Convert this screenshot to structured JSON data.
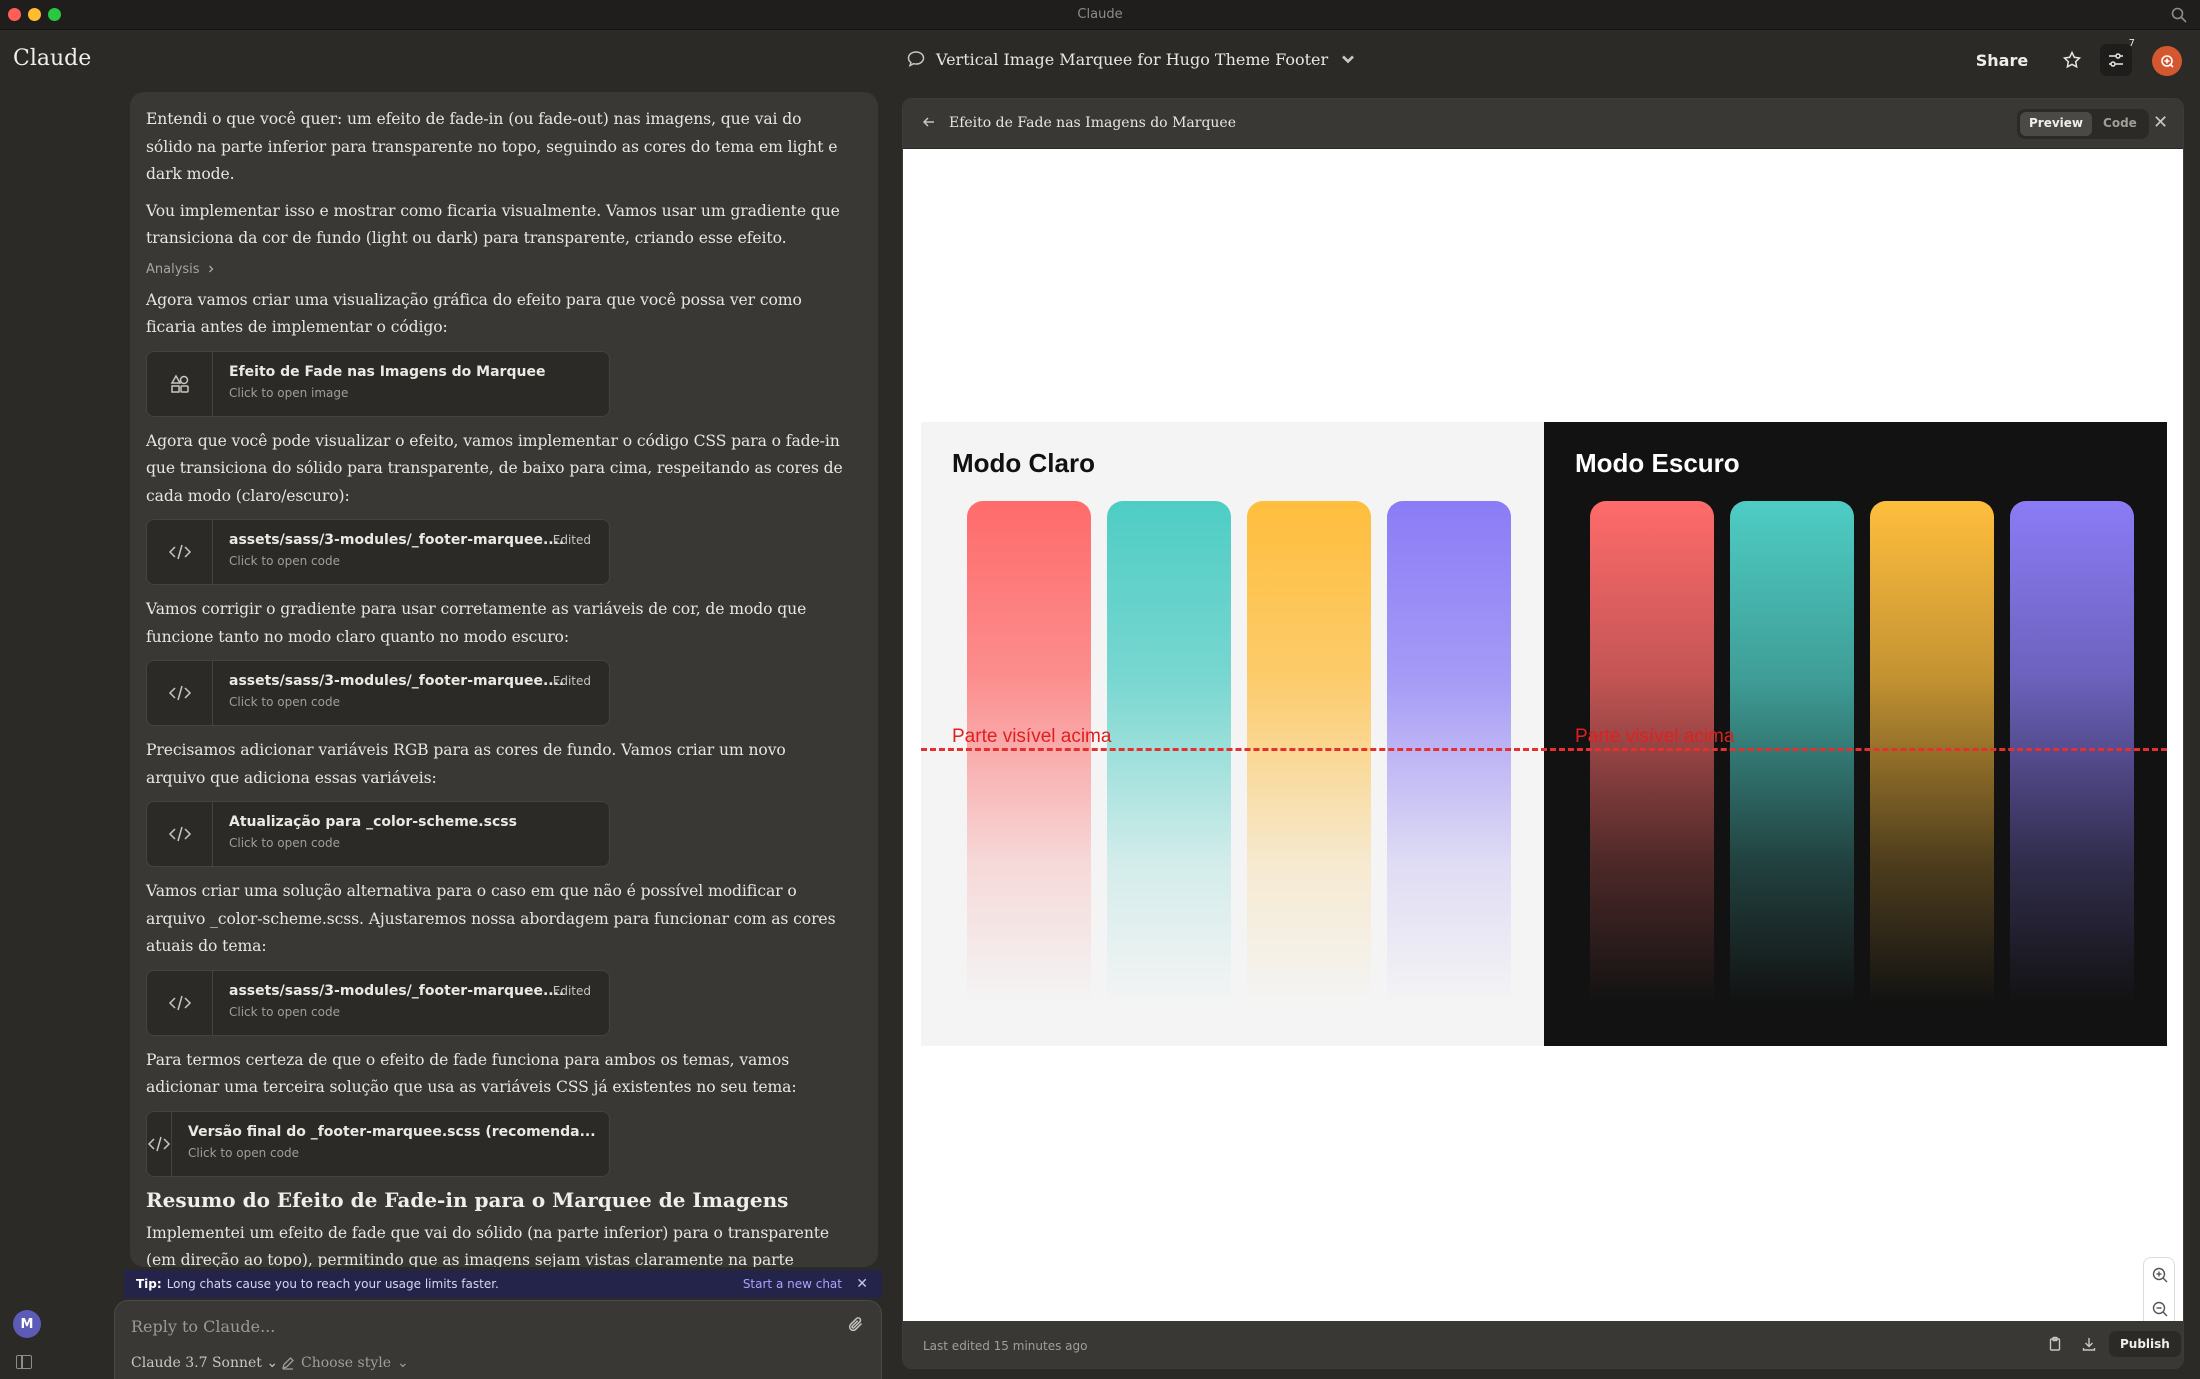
{
  "window": {
    "title": "Claude"
  },
  "header": {
    "brand": "Claude",
    "conversation_title": "Vertical Image Marquee for Hugo Theme Footer",
    "share_label": "Share",
    "notifications_count": "7"
  },
  "chat": {
    "paragraphs": [
      "Entendi o que você quer: um efeito de fade-in (ou fade-out) nas imagens, que vai do sólido na parte inferior para transparente no topo, seguindo as cores do tema em light e dark mode.",
      "Vou implementar isso e mostrar como ficaria visualmente. Vamos usar um gradiente que transiciona da cor de fundo (light ou dark) para transparente, criando esse efeito.",
      "Agora vamos criar uma visualização gráfica do efeito para que você possa ver como ficaria antes de implementar o código:",
      "Agora que você pode visualizar o efeito, vamos implementar o código CSS para o fade-in que transiciona do sólido para transparente, de baixo para cima, respeitando as cores de cada modo (claro/escuro):",
      "Vamos corrigir o gradiente para usar corretamente as variáveis de cor, de modo que funcione tanto no modo claro quanto no modo escuro:",
      "Precisamos adicionar variáveis RGB para as cores de fundo. Vamos criar um novo arquivo que adiciona essas variáveis:",
      "Vamos criar uma solução alternativa para o caso em que não é possível modificar o arquivo _color-scheme.scss. Ajustaremos nossa abordagem para funcionar com as cores atuais do tema:",
      "Para termos certeza de que o efeito de fade funciona para ambos os temas, vamos adicionar uma terceira solução que usa as variáveis CSS já existentes no seu tema:",
      "Implementei um efeito de fade que vai do sólido (na parte inferior) para o transparente (em direção ao topo), permitindo que as imagens sejam vistas claramente na parte"
    ],
    "analysis_label": "Analysis",
    "artifacts": [
      {
        "title": "Efeito de Fade nas Imagens do Marquee",
        "subtitle": "Click to open image",
        "edited": ""
      },
      {
        "title": "assets/sass/3-modules/_footer-marquee....",
        "subtitle": "Click to open code",
        "edited": "Edited"
      },
      {
        "title": "assets/sass/3-modules/_footer-marquee....",
        "subtitle": "Click to open code",
        "edited": "Edited"
      },
      {
        "title": "Atualização para _color-scheme.scss",
        "subtitle": "Click to open code",
        "edited": ""
      },
      {
        "title": "assets/sass/3-modules/_footer-marquee....",
        "subtitle": "Click to open code",
        "edited": "Edited"
      },
      {
        "title": "Versão final do _footer-marquee.scss (recomenda...",
        "subtitle": "Click to open code",
        "edited": ""
      }
    ],
    "summary_heading": "Resumo do Efeito de Fade-in para o Marquee de Imagens"
  },
  "tip": {
    "label": "Tip:",
    "text": "Long chats cause you to reach your usage limits faster.",
    "link": "Start a new chat"
  },
  "composer": {
    "placeholder": "Reply to Claude...",
    "model": "Claude 3.7 Sonnet",
    "style": "Choose style"
  },
  "user": {
    "initial": "M"
  },
  "artifact_panel": {
    "title": "Efeito de Fade nas Imagens do Marquee",
    "tabs": [
      "Preview",
      "Code"
    ],
    "active_tab": "Preview",
    "last_edited": "Last edited 15 minutes ago",
    "publish_label": "Publish",
    "preview": {
      "light_title": "Modo Claro",
      "dark_title": "Modo Escuro",
      "visible_label": "Parte visível acima",
      "bar_colors": [
        "#ff6b6b",
        "#4ecdc4",
        "#ffbe3d",
        "#8b7cf6"
      ],
      "light_bg": "#f4f4f4",
      "dark_bg": "#121212"
    }
  }
}
